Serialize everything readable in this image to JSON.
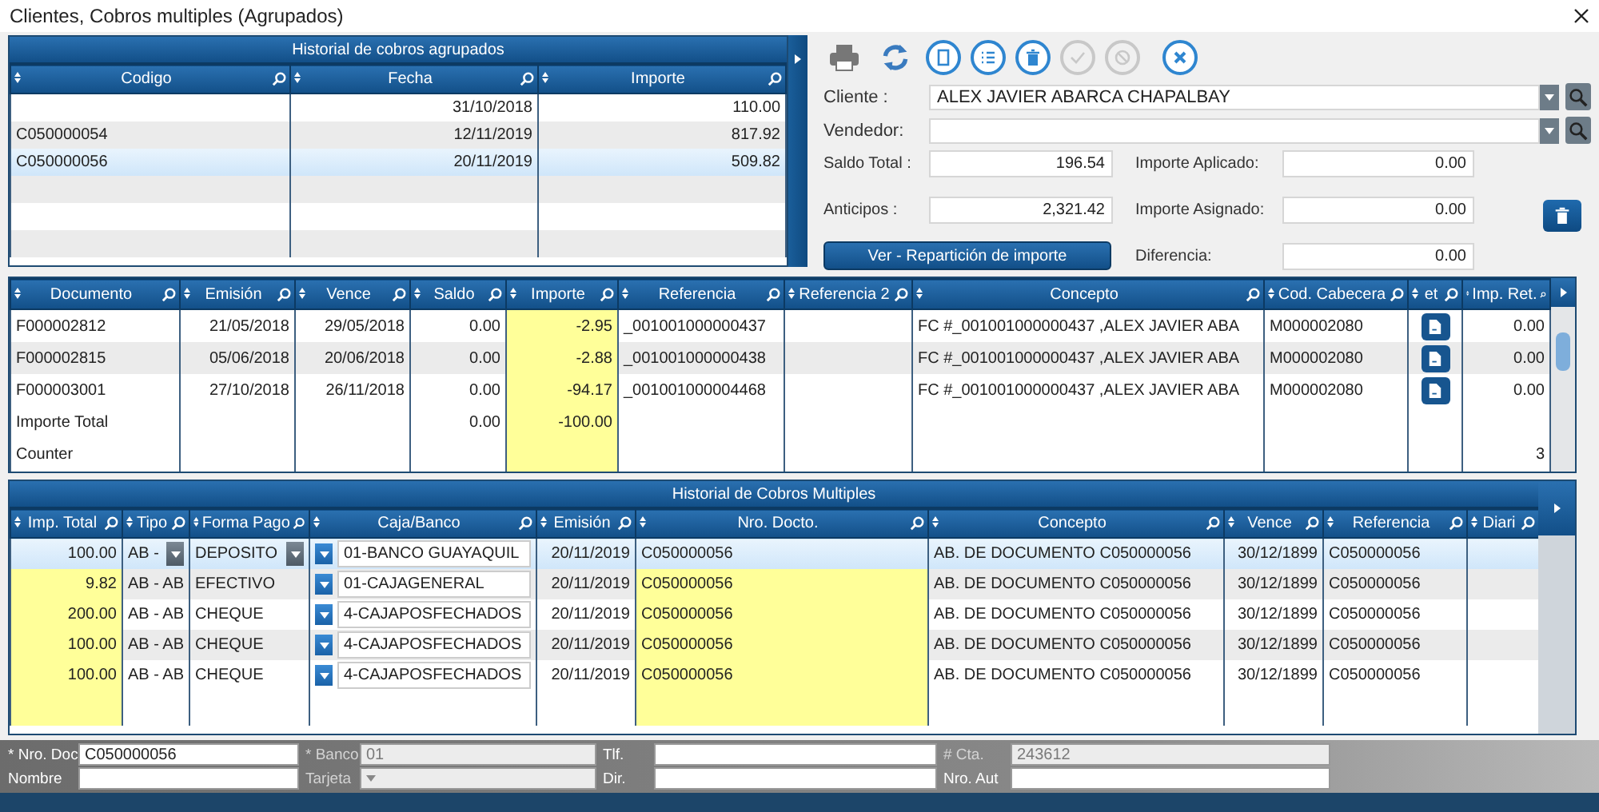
{
  "window": {
    "title": "Clientes, Cobros multiples (Agrupados)"
  },
  "history": {
    "title": "Historial de cobros agrupados",
    "columns": [
      {
        "label": "Codigo"
      },
      {
        "label": "Fecha"
      },
      {
        "label": "Importe"
      }
    ],
    "rows": [
      {
        "fecha": "31/10/2018",
        "importe": "110.00",
        "selected": false
      },
      {
        "codigo": "C050000054",
        "fecha": "12/11/2019",
        "importe": "817.92",
        "selected": false
      },
      {
        "codigo": "C050000056",
        "fecha": "20/11/2019",
        "importe": "509.82",
        "selected": true
      }
    ]
  },
  "toolbar": [
    {
      "kind": "print",
      "disabled": false
    },
    {
      "kind": "refresh",
      "disabled": false
    },
    {
      "kind": "new",
      "disabled": false
    },
    {
      "kind": "list",
      "disabled": false
    },
    {
      "kind": "delete",
      "disabled": false
    },
    {
      "kind": "confirm",
      "disabled": true
    },
    {
      "kind": "cancel",
      "disabled": true
    },
    {
      "kind": "close",
      "disabled": false
    }
  ],
  "form": {
    "cliente": {
      "label": "Cliente :",
      "value": "ALEX JAVIER ABARCA CHAPALBAY"
    },
    "vendedor": {
      "label": "Vendedor:"
    },
    "saldo_total": {
      "label": "Saldo Total :",
      "value": "196.54"
    },
    "anticipos": {
      "label": "Anticipos :",
      "value": "2,321.42"
    },
    "importe_aplicado": {
      "label": "Importe Aplicado:",
      "value": "0.00"
    },
    "importe_asignado": {
      "label": "Importe Asignado:",
      "value": "0.00"
    },
    "diferencia": {
      "label": "Diferencia:",
      "value": "0.00"
    },
    "button": "Ver - Repartición de importe"
  },
  "documents": {
    "columns": [
      {
        "label": "Documento",
        "highlight": false
      },
      {
        "label": "Emisión",
        "highlight": false
      },
      {
        "label": "Vence",
        "highlight": false
      },
      {
        "label": "Saldo",
        "highlight": false
      },
      {
        "label": "Importe",
        "highlight": true
      },
      {
        "label": "Referencia",
        "highlight": false
      },
      {
        "label": "Referencia 2",
        "highlight": false
      },
      {
        "label": "Concepto",
        "highlight": false
      },
      {
        "label": "Cod. Cabecera",
        "highlight": false
      },
      {
        "label": "et",
        "highlight": false
      },
      {
        "label": "Imp. Ret.",
        "highlight": false
      }
    ],
    "rows": [
      {
        "documento": "F000002812",
        "emision": "21/05/2018",
        "vence": "29/05/2018",
        "saldo": "0.00",
        "importe": "-2.95",
        "referencia": "_001001000000437",
        "concepto": "FC #_001001000000437 ,ALEX JAVIER ABA",
        "cod_cabecera": "M000002080",
        "imp_ret": "0.00",
        "selected": false
      },
      {
        "documento": "F000002815",
        "emision": "05/06/2018",
        "vence": "20/06/2018",
        "saldo": "0.00",
        "importe": "-2.88",
        "referencia": "_001001000000438",
        "concepto": "FC #_001001000000437 ,ALEX JAVIER ABA",
        "cod_cabecera": "M000002080",
        "imp_ret": "0.00",
        "selected": false
      },
      {
        "documento": "F000003001",
        "emision": "27/10/2018",
        "vence": "26/11/2018",
        "saldo": "0.00",
        "importe": "-94.17",
        "referencia": "_001001000004468",
        "concepto": "FC #_001001000000437 ,ALEX JAVIER ABA",
        "cod_cabecera": "M000002080",
        "imp_ret": "0.00",
        "selected": false
      }
    ],
    "total": {
      "label": "Importe Total",
      "saldo": "0.00",
      "importe": "-100.00"
    },
    "counter": {
      "label": "Counter",
      "value": "3"
    }
  },
  "payments": {
    "title": "Historial de Cobros Multiples",
    "columns": [
      {
        "label": "Imp. Total",
        "highlight": true
      },
      {
        "label": "Tipo",
        "highlight": false
      },
      {
        "label": "Forma Pago",
        "highlight": false
      },
      {
        "label": "Caja/Banco",
        "highlight": false
      },
      {
        "label": "Emisión",
        "highlight": false
      },
      {
        "label": "Nro. Docto.",
        "highlight": true
      },
      {
        "label": "Concepto",
        "highlight": false
      },
      {
        "label": "Vence",
        "highlight": false
      },
      {
        "label": "Referencia",
        "highlight": false
      },
      {
        "label": "Diari",
        "highlight": false
      }
    ],
    "rows": [
      {
        "imp_total": "100.00",
        "tipo": "AB -",
        "forma_pago": "DEPOSITO",
        "caja_banco": "01-BANCO GUAYAQUIL",
        "emision": "20/11/2019",
        "nro_docto": "C050000056",
        "concepto": "AB. DE DOCUMENTO C050000056",
        "vence": "30/12/1899",
        "referencia": "C050000056",
        "selected": true
      },
      {
        "imp_total": "9.82",
        "tipo": "AB - AB",
        "forma_pago": "EFECTIVO",
        "caja_banco": "01-CAJAGENERAL",
        "emision": "20/11/2019",
        "nro_docto": "C050000056",
        "concepto": "AB. DE DOCUMENTO C050000056",
        "vence": "30/12/1899",
        "referencia": "C050000056",
        "selected": false
      },
      {
        "imp_total": "200.00",
        "tipo": "AB - AB",
        "forma_pago": "CHEQUE",
        "caja_banco": "4-CAJAPOSFECHADOS",
        "emision": "20/11/2019",
        "nro_docto": "C050000056",
        "concepto": "AB. DE DOCUMENTO C050000056",
        "vence": "30/12/1899",
        "referencia": "C050000056",
        "selected": false
      },
      {
        "imp_total": "100.00",
        "tipo": "AB - AB",
        "forma_pago": "CHEQUE",
        "caja_banco": "4-CAJAPOSFECHADOS",
        "emision": "20/11/2019",
        "nro_docto": "C050000056",
        "concepto": "AB. DE DOCUMENTO C050000056",
        "vence": "30/12/1899",
        "referencia": "C050000056",
        "selected": false
      },
      {
        "imp_total": "100.00",
        "tipo": "AB - AB",
        "forma_pago": "CHEQUE",
        "caja_banco": "4-CAJAPOSFECHADOS",
        "emision": "20/11/2019",
        "nro_docto": "C050000056",
        "concepto": "AB. DE DOCUMENTO C050000056",
        "vence": "30/12/1899",
        "referencia": "C050000056",
        "selected": false
      }
    ]
  },
  "footer": [
    {
      "label": "* Nro. Doc",
      "value": "C050000056",
      "kind": "text",
      "disabled": false
    },
    {
      "label": "* Banco",
      "value": "01",
      "kind": "text",
      "disabled": true
    },
    {
      "label": "Tlf.",
      "kind": "text",
      "disabled": false
    },
    {
      "label": "# Cta.",
      "value": "243612",
      "kind": "text",
      "disabled": true
    },
    {
      "label": "Nombre",
      "kind": "text",
      "disabled": false
    },
    {
      "label": "Tarjeta",
      "kind": "select",
      "disabled": true
    },
    {
      "label": "Dir.",
      "kind": "text",
      "disabled": false
    },
    {
      "label": "Nro. Aut",
      "kind": "text",
      "disabled": false
    }
  ]
}
